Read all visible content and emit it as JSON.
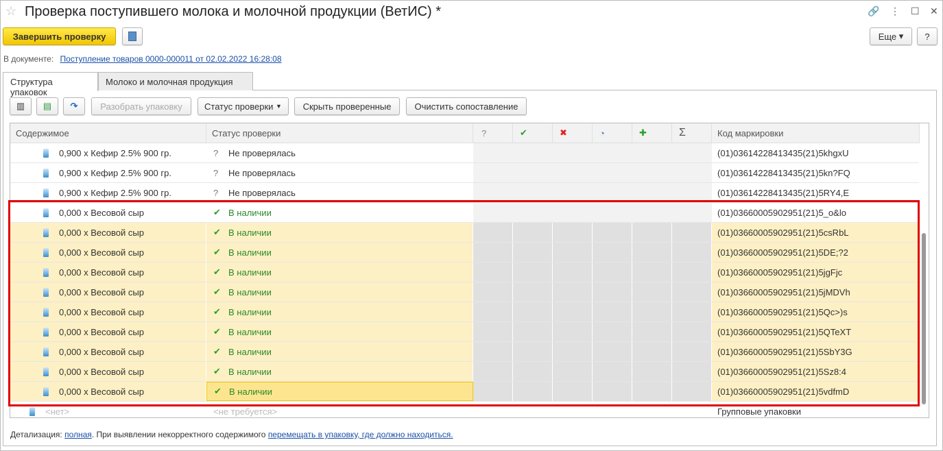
{
  "window": {
    "title": "Проверка поступившего молока и молочной продукции (ВетИС) *"
  },
  "toolbar": {
    "finish": "Завершить проверку",
    "more": "Еще",
    "help": "?"
  },
  "doc": {
    "label": "В документе:",
    "link": "Поступление товаров 0000-000011 от 02.02.2022 16:28:08"
  },
  "tabs": [
    {
      "label": "Структура упаковок"
    },
    {
      "label": "Молоко и молочная продукция"
    }
  ],
  "panel_toolbar": {
    "unpack": "Разобрать упаковку",
    "status": "Статус проверки",
    "hide": "Скрыть проверенные",
    "clear": "Очистить сопоставление"
  },
  "columns": {
    "content": "Содержимое",
    "status": "Статус проверки",
    "q": "?",
    "ok": "✔",
    "err": "✖",
    "clock": "◔",
    "plus": "✚",
    "sum": "Σ",
    "code": "Код маркировки"
  },
  "rows": [
    {
      "content": "0,900 х Кефир 2.5% 900 гр.",
      "status": "Не проверялась",
      "state": "unchecked",
      "code": "(01)03614228413435(21)5khgxU"
    },
    {
      "content": "0,900 х Кефир 2.5% 900 гр.",
      "status": "Не проверялась",
      "state": "unchecked",
      "code": "(01)03614228413435(21)5kn?FQ"
    },
    {
      "content": "0,900 х Кефир 2.5% 900 гр.",
      "status": "Не проверялась",
      "state": "unchecked",
      "code": "(01)03614228413435(21)5RY4,E"
    },
    {
      "content": "0,000 х Весовой сыр",
      "status": "В наличии",
      "state": "present",
      "code": "(01)03660005902951(21)5_o&lo"
    },
    {
      "content": "0,000 х Весовой сыр",
      "status": "В наличии",
      "state": "present-hl",
      "code": "(01)03660005902951(21)5csRbL"
    },
    {
      "content": "0,000 х Весовой сыр",
      "status": "В наличии",
      "state": "present-hl",
      "code": "(01)03660005902951(21)5DE;?2"
    },
    {
      "content": "0,000 х Весовой сыр",
      "status": "В наличии",
      "state": "present-hl",
      "code": "(01)03660005902951(21)5jgFjc"
    },
    {
      "content": "0,000 х Весовой сыр",
      "status": "В наличии",
      "state": "present-hl",
      "code": "(01)03660005902951(21)5jMDVh"
    },
    {
      "content": "0,000 х Весовой сыр",
      "status": "В наличии",
      "state": "present-hl",
      "code": "(01)03660005902951(21)5Qc>)s"
    },
    {
      "content": "0,000 х Весовой сыр",
      "status": "В наличии",
      "state": "present-hl",
      "code": "(01)03660005902951(21)5QTeXT"
    },
    {
      "content": "0,000 х Весовой сыр",
      "status": "В наличии",
      "state": "present-hl",
      "code": "(01)03660005902951(21)5SbY3G"
    },
    {
      "content": "0,000 х Весовой сыр",
      "status": "В наличии",
      "state": "present-hl",
      "code": "(01)03660005902951(21)5Sz8:4"
    },
    {
      "content": "0,000 х Весовой сыр",
      "status": "В наличии",
      "state": "present-sel",
      "code": "(01)03660005902951(21)5vdfmD"
    },
    {
      "content": "<нет>",
      "status": "<не требуется>",
      "state": "group",
      "code": "Групповые упаковки"
    }
  ],
  "footer": {
    "prefix": "Детализация:",
    "link1": "полная",
    "middle": ". При выявлении некорректного содержимого",
    "link2": "перемещать в упаковку, где должно находиться."
  },
  "colors": {
    "accent": "#f2c600",
    "highlight": "#fdf0c4",
    "selected": "#fde58f",
    "ok": "#2aa02a",
    "err": "#e02020",
    "frame": "#e00000"
  }
}
